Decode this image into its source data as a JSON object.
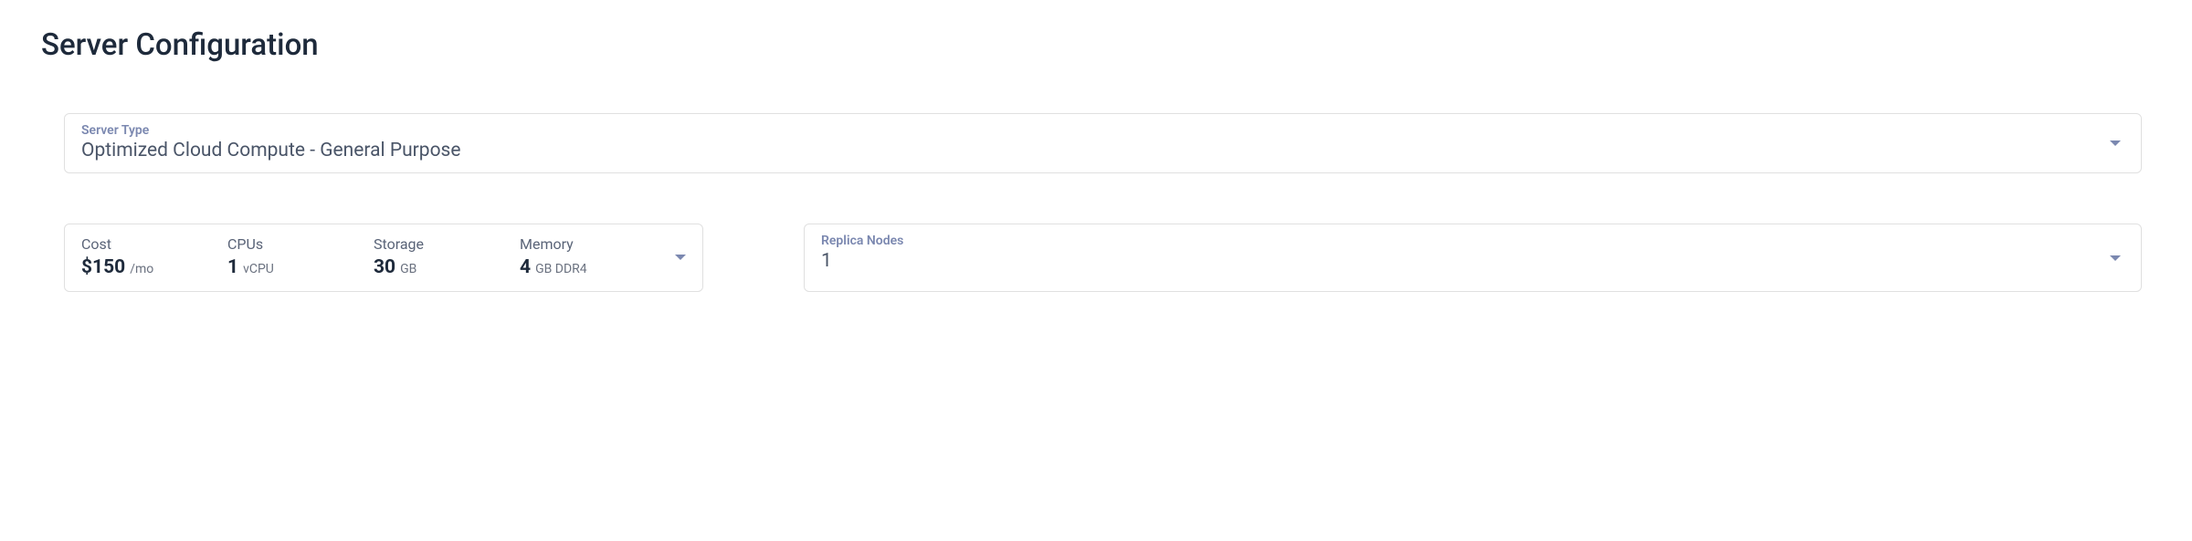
{
  "title": "Server Configuration",
  "serverType": {
    "label": "Server Type",
    "value": "Optimized Cloud Compute - General Purpose"
  },
  "specs": {
    "cost": {
      "label": "Cost",
      "value": "$150",
      "unit": "/mo"
    },
    "cpus": {
      "label": "CPUs",
      "value": "1",
      "unit": "vCPU"
    },
    "storage": {
      "label": "Storage",
      "value": "30",
      "unit": "GB"
    },
    "memory": {
      "label": "Memory",
      "value": "4",
      "unit": "GB DDR4"
    }
  },
  "replica": {
    "label": "Replica Nodes",
    "value": "1"
  }
}
